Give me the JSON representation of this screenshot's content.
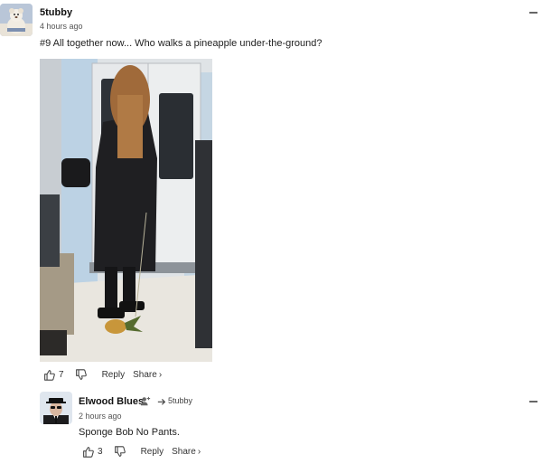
{
  "comment": {
    "username": "5tubby",
    "timestamp": "4 hours ago",
    "text": "#9 All together now... Who walks a pineapple under-the-ground?",
    "actions": {
      "like_count": "7",
      "reply_label": "Reply",
      "share_label": "Share",
      "share_chevron": "›"
    }
  },
  "reply": {
    "username": "Elwood Blues",
    "reply_to_user": "5tubby",
    "timestamp": "2 hours ago",
    "text": "Sponge Bob No Pants.",
    "actions": {
      "like_count": "3",
      "reply_label": "Reply",
      "share_label": "Share",
      "share_chevron": "›"
    }
  },
  "icons": {
    "thumbs_up": "thumbs-up-icon",
    "thumbs_down": "thumbs-down-icon",
    "collapse": "minus-icon",
    "follow": "add-person-icon",
    "reply_arrow": "reply-arrow-icon"
  },
  "colors": {
    "text_primary": "#111111",
    "text_secondary": "#555555",
    "icon": "#444444"
  }
}
